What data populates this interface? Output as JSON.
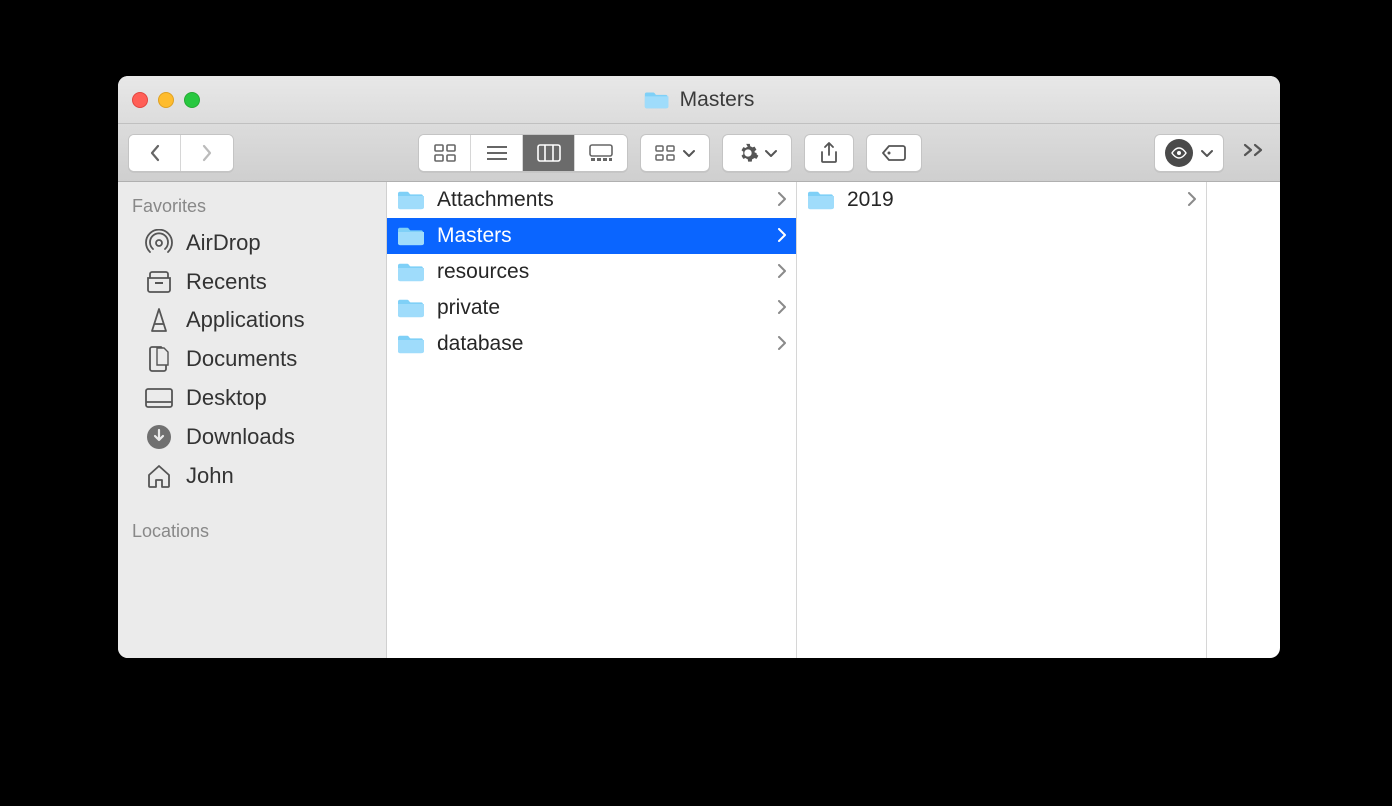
{
  "window": {
    "title": "Masters"
  },
  "sidebar": {
    "sections": [
      {
        "heading": "Favorites",
        "items": [
          {
            "icon": "airdrop",
            "label": "AirDrop"
          },
          {
            "icon": "recents",
            "label": "Recents"
          },
          {
            "icon": "apps",
            "label": "Applications"
          },
          {
            "icon": "docs",
            "label": "Documents"
          },
          {
            "icon": "desktop",
            "label": "Desktop"
          },
          {
            "icon": "download",
            "label": "Downloads"
          },
          {
            "icon": "home",
            "label": "John"
          }
        ]
      },
      {
        "heading": "Locations",
        "items": []
      }
    ]
  },
  "columns": [
    {
      "items": [
        {
          "label": "Attachments",
          "hasChildren": true,
          "selected": false
        },
        {
          "label": "Masters",
          "hasChildren": true,
          "selected": true
        },
        {
          "label": "resources",
          "hasChildren": true,
          "selected": false
        },
        {
          "label": "private",
          "hasChildren": true,
          "selected": false
        },
        {
          "label": "database",
          "hasChildren": true,
          "selected": false
        }
      ]
    },
    {
      "items": [
        {
          "label": "2019",
          "hasChildren": true,
          "selected": false
        }
      ]
    }
  ]
}
